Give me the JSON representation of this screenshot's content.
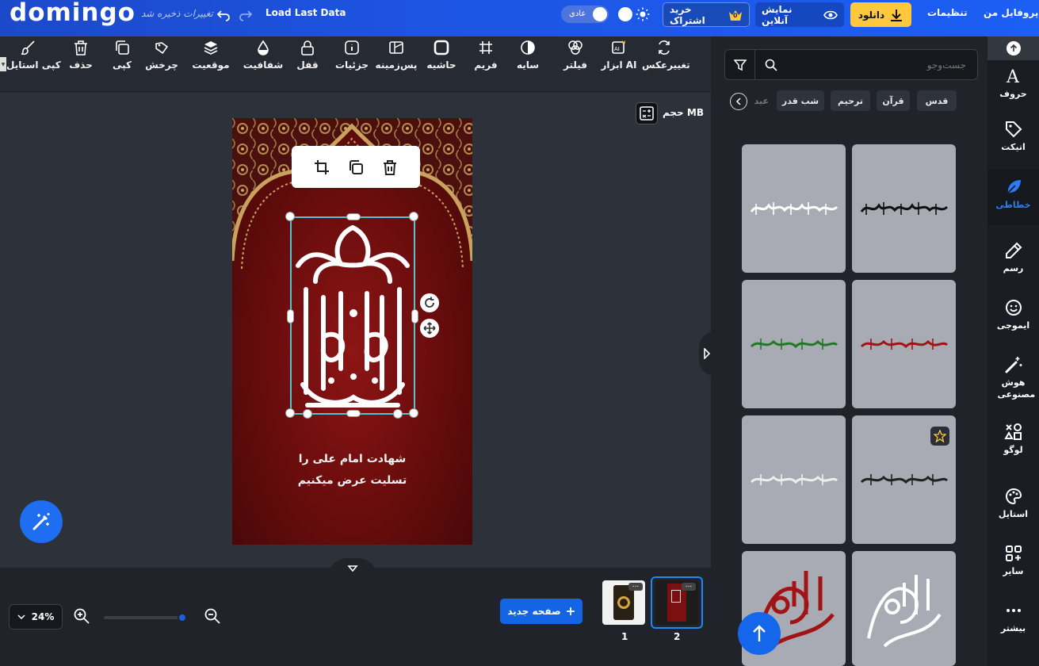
{
  "topbar": {
    "logo": "domingo",
    "unsaved": "تغییرات ذخیره شد",
    "load_last": "Load Last Data",
    "mode": "عادی",
    "buy": "خرید اشتراک",
    "buy_badge": "0",
    "online": "نمایش آنلاین",
    "download": "دانلود",
    "settings": "تنظیمات",
    "profile": "پروفایل من"
  },
  "toolbar": {
    "tools": [
      {
        "label": "تغییرعکس",
        "icon": "replace-image-icon"
      },
      {
        "label": "ابزار AI",
        "icon": "ai-tools-icon"
      },
      {
        "label": "فیلتر",
        "icon": "filter-icon"
      },
      {
        "label": "سایه",
        "icon": "shadow-icon"
      },
      {
        "label": "فریم",
        "icon": "frame-icon"
      },
      {
        "label": "حاشیه",
        "icon": "border-icon"
      },
      {
        "label": "پس‌زمینه",
        "icon": "background-icon"
      },
      {
        "label": "جزئیات",
        "icon": "details-icon"
      },
      {
        "label": "قفل",
        "icon": "lock-icon"
      },
      {
        "label": "شفافیت",
        "icon": "opacity-icon"
      },
      {
        "label": "موقعیت",
        "icon": "layers-icon"
      },
      {
        "label": "چرخش",
        "icon": "rotate-icon"
      },
      {
        "label": "کپی",
        "icon": "copy-icon"
      },
      {
        "label": "حذف",
        "icon": "trash-icon"
      },
      {
        "label": "کپی استایل",
        "icon": "brush-icon"
      }
    ]
  },
  "canvas": {
    "size_label": "حجم MB",
    "caption_line1": "شهادت امام علی را",
    "caption_line2": "تسلیت عرض میکنیم"
  },
  "bottom": {
    "zoom": "24%",
    "zoom_level": 0.95,
    "new_page": "صفحه جدید",
    "pages": [
      "1",
      "2"
    ],
    "page_menu": "..."
  },
  "panel": {
    "search_placeholder": "جست‌وجو",
    "chips": [
      "قدس",
      "قرآن",
      "ترحیم",
      "شب قدر",
      "عید"
    ]
  },
  "sidebar": {
    "items": [
      {
        "label": "حروف",
        "icon": "letters-icon"
      },
      {
        "label": "اتیکت",
        "icon": "tag-icon"
      },
      {
        "label": "خطاطی",
        "icon": "feather-icon"
      },
      {
        "label": "رسم",
        "icon": "pencil-icon"
      },
      {
        "label": "ایموجی",
        "icon": "emoji-icon"
      },
      {
        "label": "هوش مصنوعی",
        "icon": "magic-wand-icon"
      },
      {
        "label": "لوگو",
        "icon": "shapes-icon"
      },
      {
        "label": "استایل",
        "icon": "palette-icon"
      },
      {
        "label": "سایر",
        "icon": "grid-plus-icon"
      },
      {
        "label": "بیشتر",
        "icon": "more-dots-icon"
      }
    ]
  },
  "colors": {
    "brand": "#1d55e4",
    "accent": "#1464e6",
    "download": "#ffc83d",
    "active_sidebar": "#2f7bf5",
    "selection": "#53c3d6"
  }
}
